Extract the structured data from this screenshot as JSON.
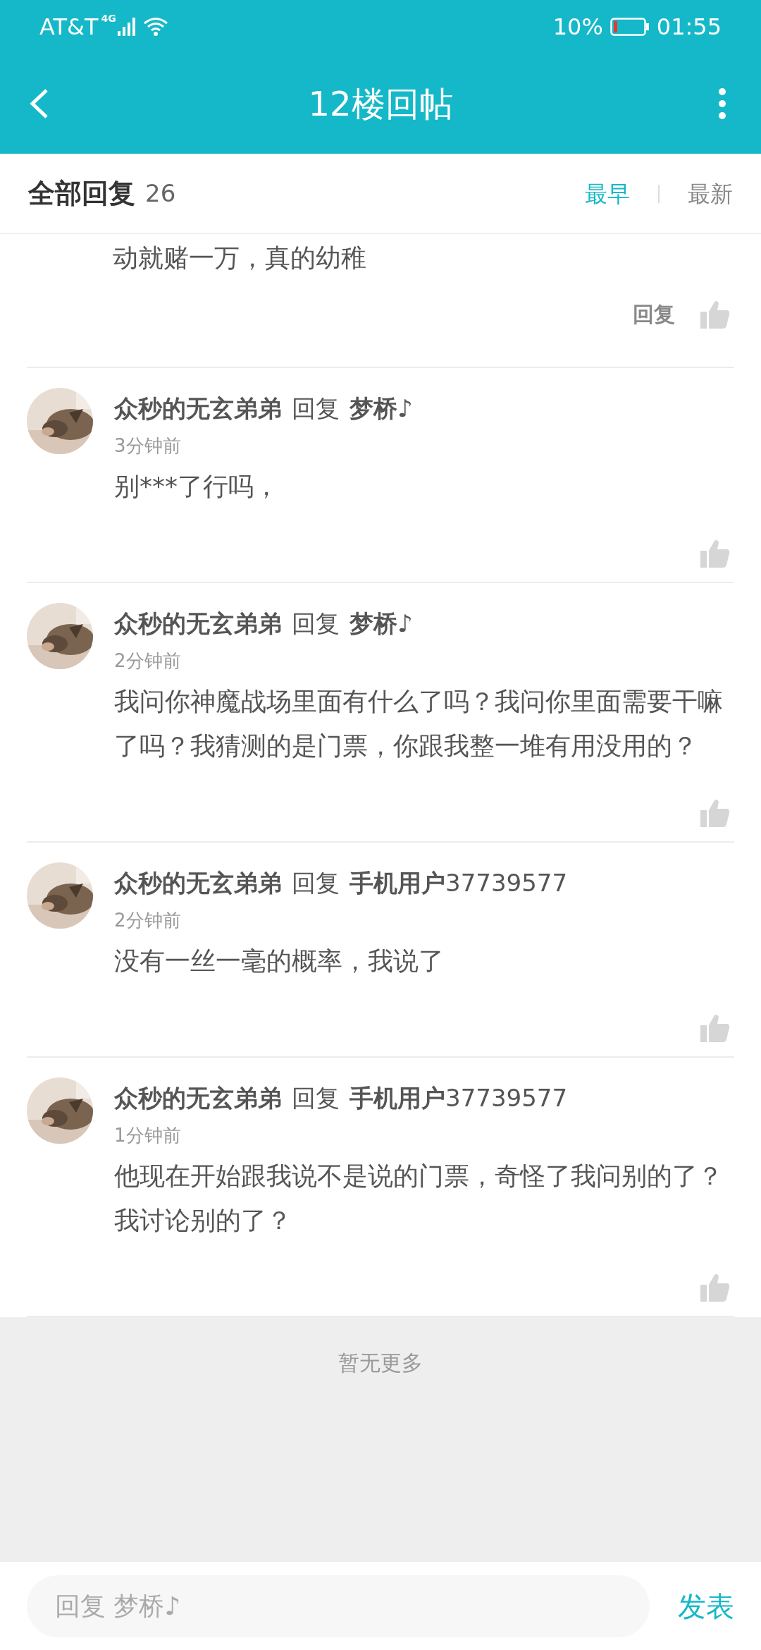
{
  "status_bar": {
    "carrier": "AT&T",
    "network": "4G",
    "battery": "10%",
    "time": "01:55"
  },
  "header": {
    "title": "12楼回帖"
  },
  "sort_bar": {
    "label": "全部回复",
    "count": "26",
    "tabs": [
      {
        "label": "最早",
        "selected": true
      },
      {
        "label": "最新",
        "selected": false
      }
    ]
  },
  "comments": [
    {
      "kind": "partial",
      "text": "动就赌一万，真的幼稚",
      "reply_button": "回复"
    },
    {
      "kind": "full",
      "author": "众秒的无玄弟弟",
      "reply_label": "回复",
      "reply_to": "**梦桥♪**",
      "time": "3分钟前",
      "text": "别***了行吗，"
    },
    {
      "kind": "full",
      "author": "众秒的无玄弟弟",
      "reply_label": "回复",
      "reply_to": "**梦桥♪**",
      "time": "2分钟前",
      "text": "我问你神魔战场里面有什么了吗？我问你里面需要干嘛了吗？我猜测的是门票，你跟我整一堆有用没用的？"
    },
    {
      "kind": "full",
      "author": "众秒的无玄弟弟",
      "reply_label": "回复",
      "reply_to": "**手机用户**37739577",
      "time": "2分钟前",
      "text": "没有一丝一毫的概率，我说了"
    },
    {
      "kind": "full",
      "author": "众秒的无玄弟弟",
      "reply_label": "回复",
      "reply_to": "**手机用户**37739577",
      "time": "1分钟前",
      "text": "他现在开始跟我说不是说的门票，奇怪了我问别的了？我讨论别的了？"
    }
  ],
  "footer": {
    "text": "暂无更多"
  },
  "reply_bar": {
    "placeholder": "回复 梦桥♪",
    "send": "发表"
  }
}
